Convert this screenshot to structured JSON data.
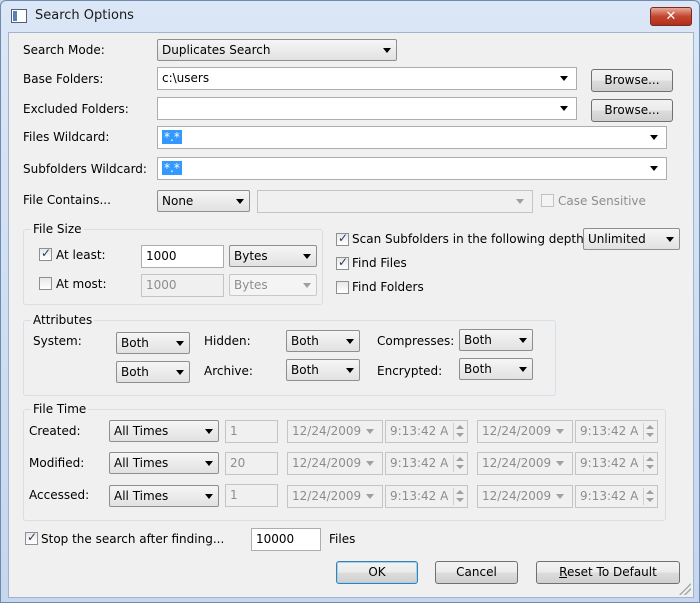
{
  "window": {
    "title": "Search Options",
    "close_label": "✕"
  },
  "search_mode": {
    "label": "Search Mode:",
    "value": "Duplicates Search"
  },
  "base_folders": {
    "label": "Base Folders:",
    "value": "c:\\users",
    "browse": "Browse..."
  },
  "excluded_folders": {
    "label": "Excluded Folders:",
    "value": "",
    "browse": "Browse..."
  },
  "files_wildcard": {
    "label": "Files Wildcard:",
    "value": "*.*"
  },
  "subfolders_wildcard": {
    "label": "Subfolders Wildcard:",
    "value": "*.*"
  },
  "file_contains": {
    "label": "File Contains...",
    "mode": "None",
    "text": "",
    "case_sensitive": "Case Sensitive"
  },
  "file_size": {
    "group_label": "File Size",
    "at_least_label": "At least:",
    "at_least_value": "1000",
    "at_least_unit": "Bytes",
    "at_least_checked": true,
    "at_most_label": "At most:",
    "at_most_value": "1000",
    "at_most_unit": "Bytes",
    "at_most_checked": false
  },
  "scan": {
    "scan_subfolders_label": "Scan Subfolders in the following depth:",
    "depth": "Unlimited",
    "find_files_label": "Find Files",
    "find_folders_label": "Find Folders"
  },
  "attributes": {
    "group_label": "Attributes",
    "system_label": "System:",
    "system_value": "Both",
    "system2_value": "Both",
    "hidden_label": "Hidden:",
    "hidden_value": "Both",
    "archive_label": "Archive:",
    "archive_value": "Both",
    "compresses_label": "Compresses:",
    "compresses_value": "Both",
    "encrypted_label": "Encrypted:",
    "encrypted_value": "Both"
  },
  "file_time": {
    "group_label": "File Time",
    "rows": [
      {
        "label": "Created:",
        "mode": "All Times",
        "count": "1",
        "date1": "12/24/2009",
        "time1": "9:13:42 A",
        "date2": "12/24/2009",
        "time2": "9:13:42 A"
      },
      {
        "label": "Modified:",
        "mode": "All Times",
        "count": "20",
        "date1": "12/24/2009",
        "time1": "9:13:42 A",
        "date2": "12/24/2009",
        "time2": "9:13:42 A"
      },
      {
        "label": "Accessed:",
        "mode": "All Times",
        "count": "1",
        "date1": "12/24/2009",
        "time1": "9:13:42 A",
        "date2": "12/24/2009",
        "time2": "9:13:42 A"
      }
    ]
  },
  "stop_search": {
    "label": "Stop the search after finding...",
    "value": "10000",
    "unit": "Files"
  },
  "buttons": {
    "ok": "OK",
    "cancel": "Cancel",
    "reset_prefix": "R",
    "reset_rest": "eset To Default"
  }
}
